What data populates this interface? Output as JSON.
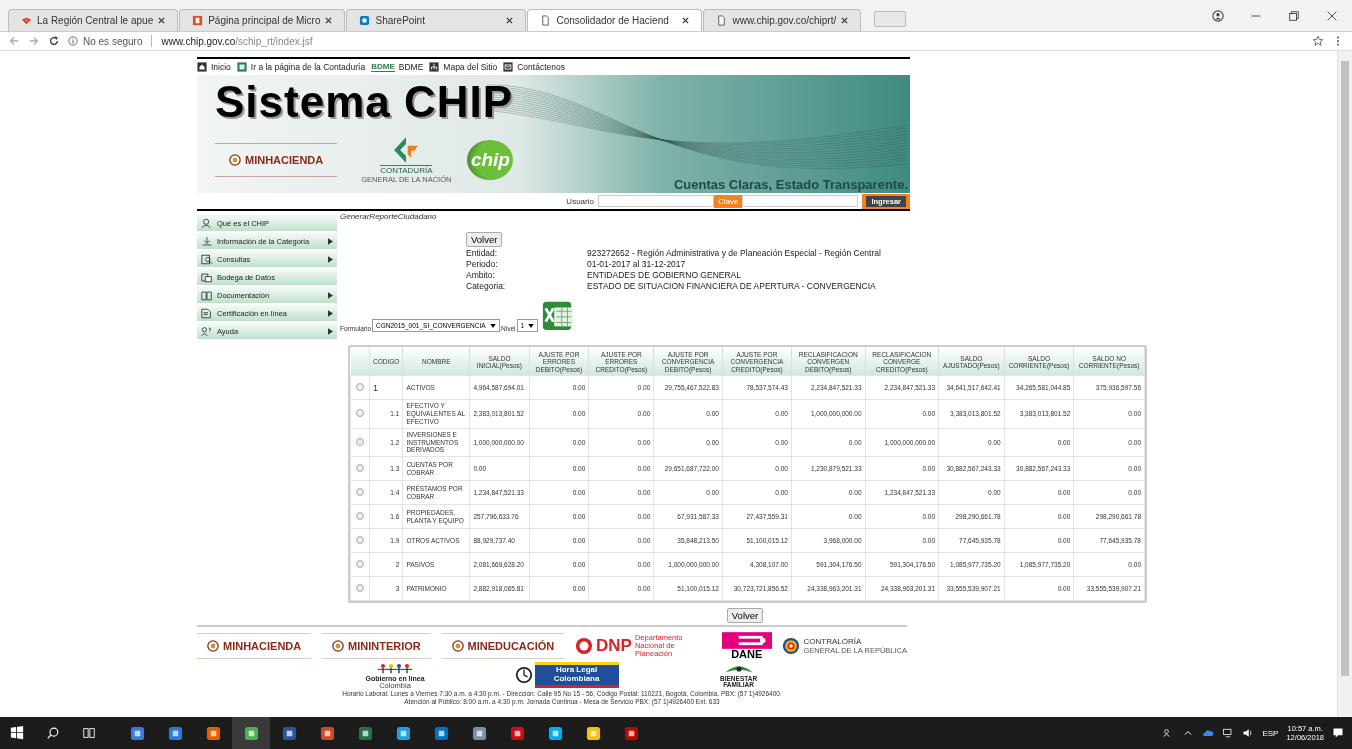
{
  "browser": {
    "tabs": [
      {
        "title": "La Región Central le apue",
        "selected": false
      },
      {
        "title": "Página principal de Micro",
        "selected": false
      },
      {
        "title": "SharePoint",
        "selected": false
      },
      {
        "title": "Consolidador de Haciend",
        "selected": true
      },
      {
        "title": "www.chip.gov.co/chiprt/",
        "selected": false
      }
    ],
    "address": {
      "security": "No es seguro",
      "host": "www.chip.gov.co",
      "path": "/schip_rt/index.jsf"
    }
  },
  "top_links": [
    {
      "label": "Inicio"
    },
    {
      "label": "Ir a la página de la Contaduría"
    },
    {
      "label": "BDME",
      "logo_text": "BDME"
    },
    {
      "label": "Mapa del Sitio"
    },
    {
      "label": "Contáctenos"
    }
  ],
  "banner": {
    "title": "Sistema CHIP",
    "slogan": "Cuentas Claras, Estado Transparente.",
    "ministry": "MINHACIENDA",
    "contaduria": "CONTADURÍA",
    "contaduria_sub": "GENERAL DE LA NACIÓN",
    "chip": "chip"
  },
  "login": {
    "user_label": "Usuario",
    "password_label": "Clave",
    "button": "Ingresar"
  },
  "sidebar": {
    "items": [
      {
        "label": "Qué es el CHIP",
        "has_submenu": false
      },
      {
        "label": "Información de la Categoria",
        "has_submenu": true
      },
      {
        "label": "Consultas",
        "has_submenu": true
      },
      {
        "label": "Bodega de Datos",
        "has_submenu": false
      },
      {
        "label": "Documentación",
        "has_submenu": true
      },
      {
        "label": "Certificación en línea",
        "has_submenu": true
      },
      {
        "label": "Ayuda",
        "has_submenu": true
      }
    ]
  },
  "breadcrumb": "GenerarReporteCiudadano",
  "back_button": "Volver",
  "info": [
    {
      "label": "Entidad:",
      "value": "923272652 - Región Administrativa y de Planeación Especial - Región Central"
    },
    {
      "label": "Periodo:",
      "value": "01-01-2017 al 31-12-2017"
    },
    {
      "label": "Ambito:",
      "value": "ENTIDADES DE GOBIERNO GENERAL"
    },
    {
      "label": "Categoria:",
      "value": "ESTADO DE SITUACION FINANCIERA DE APERTURA - CONVERGENCIA"
    }
  ],
  "form": {
    "formulario_label": "Formulario",
    "formulario_value": "CGN2015_001_SI_CONVERGENCIA",
    "nivel_label": "Nivel",
    "nivel_value": "1"
  },
  "table": {
    "columns": [
      "CODIGO",
      "NOMBRE",
      "SALDO INICIAL(Pesos)",
      "AJUSTE POR ERRORES DEBITO(Pesos)",
      "AJUSTE POR ERRORES CREDITO(Pesos)",
      "AJUSTE POR CONVERGENCIA DEBITO(Pesos)",
      "AJUSTE POR CONVERGENCIA CREDITO(Pesos)",
      "RECLASIFICACION CONVERGEN DEBITO(Pesos)",
      "RECLASIFICACION CONVERGE CREDITO(Pesos)",
      "SALDO AJUSTADO(Pesos)",
      "SALDO CORRIENTE(Pesos)",
      "SALDO NO CORRIENTE(Pesos)"
    ],
    "rows": [
      {
        "selected": false,
        "kind": "root",
        "code": "1",
        "name": "ACTIVOS",
        "values": [
          "4,964,587,694.01",
          "0.00",
          "0.00",
          "29,755,467,522.83",
          "78,537,574.43",
          "2,234,847,521.33",
          "2,234,847,521.33",
          "34,641,517,642.41",
          "34,265,581,044.85",
          "375,936,597.56"
        ]
      },
      {
        "selected": false,
        "kind": "item",
        "code": "1.1",
        "name": "EFECTIVO Y EQUIVALENTES AL EFECTIVO",
        "values": [
          "2,383,013,801.52",
          "0.00",
          "0.00",
          "0.00",
          "0.00",
          "1,000,000,000.00",
          "0.00",
          "3,383,013,801.52",
          "3,383,013,801.52",
          "0.00"
        ]
      },
      {
        "selected": false,
        "kind": "item",
        "code": "1.2",
        "name": "INVERSIONES E INSTRUMENTOS DERIVADOS",
        "values": [
          "1,000,000,000.00",
          "0.00",
          "0.00",
          "0.00",
          "0.00",
          "0.00",
          "1,000,000,000.00",
          "0.00",
          "0.00",
          "0.00"
        ]
      },
      {
        "selected": false,
        "kind": "item",
        "code": "1.3",
        "name": "CUENTAS POR COBRAR",
        "values": [
          "0.00",
          "0.00",
          "0.00",
          "29,651,687,722.00",
          "0.00",
          "1,230,879,521.33",
          "0.00",
          "30,882,567,243.33",
          "30,882,567,243.33",
          "0.00"
        ]
      },
      {
        "selected": false,
        "kind": "item",
        "code": "1.4",
        "name": "PRÉSTAMOS POR COBRAR",
        "values": [
          "1,234,847,521.33",
          "0.00",
          "0.00",
          "0.00",
          "0.00",
          "0.00",
          "1,234,847,521.33",
          "0.00",
          "0.00",
          "0.00"
        ]
      },
      {
        "selected": false,
        "kind": "item",
        "code": "1.6",
        "name": "PROPIEDADES, PLANTA Y EQUIPO",
        "values": [
          "257,796,633.76",
          "0.00",
          "0.00",
          "67,931,587.33",
          "27,437,559.31",
          "0.00",
          "0.00",
          "298,290,661.78",
          "0.00",
          "298,290,661.78"
        ]
      },
      {
        "selected": false,
        "kind": "item",
        "code": "1.9",
        "name": "OTROS ACTIVOS",
        "values": [
          "88,929,737.40",
          "0.00",
          "0.00",
          "35,848,213.50",
          "51,100,015.12",
          "3,968,000.00",
          "0.00",
          "77,645,935.78",
          "0.00",
          "77,645,935.78"
        ]
      },
      {
        "selected": false,
        "kind": "item",
        "code": "2",
        "name": "PASIVOS",
        "values": [
          "2,081,669,628.20",
          "0.00",
          "0.00",
          "1,000,000,000.00",
          "4,308,107.00",
          "591,304,176.50",
          "591,304,176.50",
          "1,085,977,735.20",
          "1,085,977,735.20",
          "0.00"
        ]
      },
      {
        "selected": false,
        "kind": "item",
        "code": "3",
        "name": "PATRIMONIO",
        "values": [
          "2,882,918,065.81",
          "0.00",
          "0.00",
          "51,100,015.12",
          "30,723,721,856.52",
          "24,338,963,201.31",
          "24,338,963,201.31",
          "33,555,539,907.21",
          "0.00",
          "33,555,539,907.21"
        ]
      }
    ]
  },
  "bottom_button": "Volver",
  "footer": {
    "logos": [
      {
        "kind": "ministry",
        "text": "MINHACIENDA"
      },
      {
        "kind": "ministry",
        "text": "MININTERIOR"
      },
      {
        "kind": "ministry",
        "text": "MINEDUCACIÓN"
      },
      {
        "kind": "dnp",
        "text": "DNP",
        "sub": "Departamento Nacional de Planeación"
      },
      {
        "kind": "dane",
        "text": "DANE"
      },
      {
        "kind": "contraloria",
        "text": "CONTRALORÍA",
        "sub": "GENERAL DE LA REPÚBLICA"
      }
    ],
    "logos2": [
      {
        "kind": "gel",
        "text": "Gobierno en línea",
        "sub": "Colombia"
      },
      {
        "kind": "hora",
        "text": "Hora Legal Colombiana"
      },
      {
        "kind": "icbf",
        "text": "BIENESTAR FAMILIAR"
      }
    ],
    "lines": [
      "Horario Laboral: Lunes a Viernes 7:30 a.m. a 4:30 p.m. - Dirección: Calle 95 No 15 - 56, Código Postal: 110221, Bogotá, Colombia. PBX: (57 1)4926400.",
      "Atención al Público: 8:00 a.m. a 4:30 p.m. Jornada Continua - Mesa de Servicio PBX: (57 1)4926400 Ext. 633"
    ]
  },
  "taskbar": {
    "language": "ESP",
    "time": "10:57 a.m.",
    "date": "12/06/2018"
  }
}
